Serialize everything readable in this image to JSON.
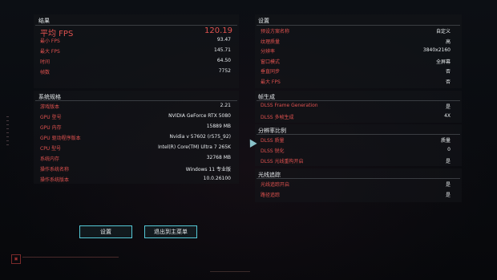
{
  "results": {
    "title": "结果",
    "avg_fps_label": "平均 FPS",
    "avg_fps_value": "120.19",
    "rows": [
      {
        "label": "最小 FPS",
        "value": "93.47"
      },
      {
        "label": "最大 FPS",
        "value": "145.71"
      },
      {
        "label": "时间",
        "value": "64.50"
      },
      {
        "label": "帧数",
        "value": "7752"
      }
    ]
  },
  "system": {
    "title": "系统规格",
    "rows": [
      {
        "label": "游戏版本",
        "value": "2.21"
      },
      {
        "label": "GPU 型号",
        "value": "NVIDIA GeForce RTX 5080"
      },
      {
        "label": "GPU 内存",
        "value": "15889 MB"
      },
      {
        "label": "GPU 驱动程序版本",
        "value": "Nvidia v 57602 (r575_92)"
      },
      {
        "label": "CPU 型号",
        "value": "Intel(R) Core(TM) Ultra 7 265K"
      },
      {
        "label": "系统内存",
        "value": "32768 MB"
      },
      {
        "label": "操作系统名称",
        "value": "Windows 11 专业版"
      },
      {
        "label": "操作系统版本",
        "value": "10.0.26100"
      }
    ]
  },
  "settings": {
    "title": "设置",
    "rows": [
      {
        "label": "预设方案名称",
        "value": "自定义"
      },
      {
        "label": "纹理质量",
        "value": "高"
      },
      {
        "label": "分辨率",
        "value": "3840x2160"
      },
      {
        "label": "窗口模式",
        "value": "全屏幕"
      },
      {
        "label": "垂直同步",
        "value": "否"
      },
      {
        "label": "最大 FPS",
        "value": "否"
      }
    ]
  },
  "frame_gen": {
    "title": "帧生成",
    "rows": [
      {
        "label": "DLSS Frame Generation",
        "value": "是"
      },
      {
        "label": "DLSS 多帧生成",
        "value": "4X"
      }
    ]
  },
  "resolution_scaling": {
    "title": "分辨率比例",
    "rows": [
      {
        "label": "DLSS 质量",
        "value": "质量"
      },
      {
        "label": "DLSS 锐化",
        "value": "0"
      },
      {
        "label": "DLSS 光线重构开启",
        "value": "是"
      }
    ]
  },
  "ray_tracing": {
    "title": "光线追踪",
    "rows": [
      {
        "label": "光线追踪开启",
        "value": "是"
      },
      {
        "label": "路径追踪",
        "value": "是"
      }
    ]
  },
  "buttons": {
    "settings": "设置",
    "exit": "退出到主菜单"
  },
  "colors": {
    "label_red": "#e0524f",
    "accent_cyan": "#55c8d6",
    "value_white": "#e8ecee"
  }
}
